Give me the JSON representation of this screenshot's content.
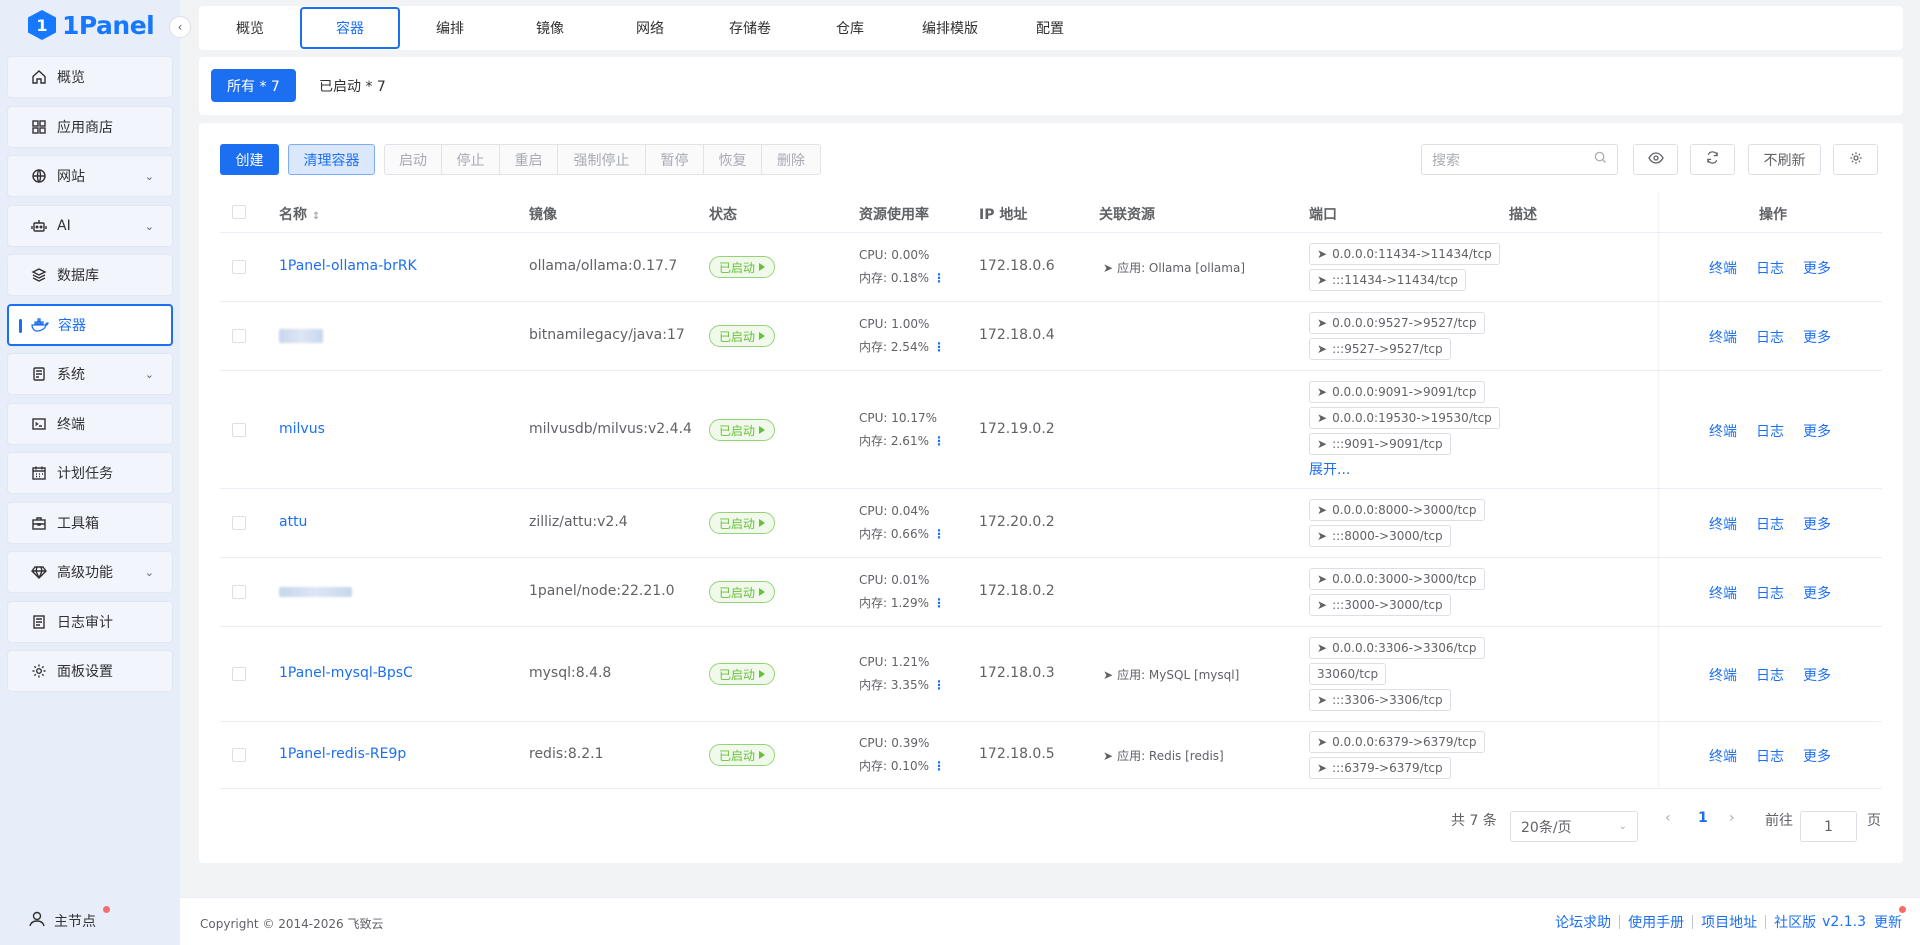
{
  "app": {
    "logo_text": "1Panel",
    "logo_mark": "1"
  },
  "sidebar": {
    "items": [
      {
        "label": "概览",
        "icon": "home-icon"
      },
      {
        "label": "应用商店",
        "icon": "grid-icon"
      },
      {
        "label": "网站",
        "icon": "globe-icon"
      },
      {
        "label": "AI",
        "icon": "robot-icon"
      },
      {
        "label": "数据库",
        "icon": "layers-icon"
      },
      {
        "label": "容器",
        "icon": "docker-icon"
      },
      {
        "label": "系统",
        "icon": "server-icon"
      },
      {
        "label": "终端",
        "icon": "terminal-icon"
      },
      {
        "label": "计划任务",
        "icon": "calendar-icon"
      },
      {
        "label": "工具箱",
        "icon": "toolbox-icon"
      },
      {
        "label": "高级功能",
        "icon": "diamond-icon"
      },
      {
        "label": "日志审计",
        "icon": "log-icon"
      },
      {
        "label": "面板设置",
        "icon": "gear-icon"
      }
    ],
    "node_label": "主节点"
  },
  "tabs": [
    "概览",
    "容器",
    "编排",
    "镜像",
    "网络",
    "存储卷",
    "仓库",
    "编排模版",
    "配置"
  ],
  "filters": {
    "all": "所有 * 7",
    "running": "已启动 * 7"
  },
  "toolbar": {
    "create": "创建",
    "clean": "清理容器",
    "group": [
      "启动",
      "停止",
      "重启",
      "强制停止",
      "暂停",
      "恢复",
      "删除"
    ],
    "search_placeholder": "搜索",
    "refresh_label": "不刷新"
  },
  "table": {
    "headers": {
      "name": "名称",
      "image": "镜像",
      "status": "状态",
      "resource": "资源使用率",
      "ip": "IP 地址",
      "related": "关联资源",
      "ports": "端口",
      "desc": "描述",
      "ops": "操作"
    },
    "rows": [
      {
        "name": "1Panel-ollama-brRK",
        "image": "ollama/ollama:0.17.7",
        "status": "已启动",
        "cpu": "CPU: 0.00%",
        "mem": "内存: 0.18%",
        "ip": "172.18.0.6",
        "related": "应用: Ollama [ollama]",
        "ports": [
          "0.0.0.0:11434->11434/tcp",
          ":::11434->11434/tcp"
        ]
      },
      {
        "name": "",
        "image": "bitnamilegacy/java:17",
        "status": "已启动",
        "cpu": "CPU: 1.00%",
        "mem": "内存: 2.54%",
        "ip": "172.18.0.4",
        "related": "",
        "ports": [
          "0.0.0.0:9527->9527/tcp",
          ":::9527->9527/tcp"
        ]
      },
      {
        "name": "milvus",
        "image": "milvusdb/milvus:v2.4.4",
        "status": "已启动",
        "cpu": "CPU: 10.17%",
        "mem": "内存: 2.61%",
        "ip": "172.19.0.2",
        "related": "",
        "ports": [
          "0.0.0.0:9091->9091/tcp",
          "0.0.0.0:19530->19530/tcp",
          ":::9091->9091/tcp"
        ],
        "expand": "展开..."
      },
      {
        "name": "attu",
        "image": "zilliz/attu:v2.4",
        "status": "已启动",
        "cpu": "CPU: 0.04%",
        "mem": "内存: 0.66%",
        "ip": "172.20.0.2",
        "related": "",
        "ports": [
          "0.0.0.0:8000->3000/tcp",
          ":::8000->3000/tcp"
        ]
      },
      {
        "name": "",
        "image": "1panel/node:22.21.0",
        "status": "已启动",
        "cpu": "CPU: 0.01%",
        "mem": "内存: 1.29%",
        "ip": "172.18.0.2",
        "related": "",
        "ports": [
          "0.0.0.0:3000->3000/tcp",
          ":::3000->3000/tcp"
        ]
      },
      {
        "name": "1Panel-mysql-BpsC",
        "image": "mysql:8.4.8",
        "status": "已启动",
        "cpu": "CPU: 1.21%",
        "mem": "内存: 3.35%",
        "ip": "172.18.0.3",
        "related": "应用: MySQL [mysql]",
        "ports": [
          "0.0.0.0:3306->3306/tcp",
          "33060/tcp",
          ":::3306->3306/tcp"
        ]
      },
      {
        "name": "1Panel-redis-RE9p",
        "image": "redis:8.2.1",
        "status": "已启动",
        "cpu": "CPU: 0.39%",
        "mem": "内存: 0.10%",
        "ip": "172.18.0.5",
        "related": "应用: Redis [redis]",
        "ports": [
          "0.0.0.0:6379->6379/tcp",
          ":::6379->6379/tcp"
        ]
      }
    ],
    "ops": [
      "终端",
      "日志",
      "更多"
    ]
  },
  "pagination": {
    "total": "共 7 条",
    "page_size": "20条/页",
    "current": "1",
    "goto_label": "前往",
    "goto_value": "1",
    "page_suffix": "页"
  },
  "footer": {
    "copyright": "Copyright © 2014-2026 飞致云",
    "links": [
      "论坛求助",
      "使用手册",
      "项目地址",
      "社区版"
    ],
    "version": "v2.1.3",
    "update": "更新"
  },
  "colors": {
    "primary": "#1d6ff2",
    "success": "#67c23a",
    "sidebar_bg": "#e7eef9"
  }
}
